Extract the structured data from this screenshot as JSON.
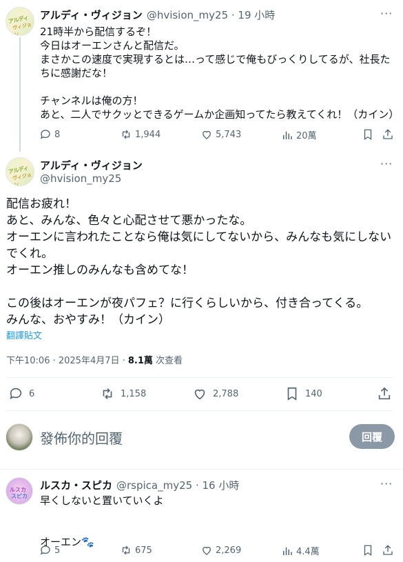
{
  "parent_tweet": {
    "avatar_text": [
      "アルディ",
      "ヴィジョン"
    ],
    "display_name": "アルディ・ヴィジョン",
    "handle_time": "@hvision_my25 · 19 小時",
    "more": "···",
    "text": "21時半から配信するぞ！\n今日はオーエンさんと配信だ。\nまさかこの速度で実現するとは…って感じで俺もびっくりしてるが、社長た\nちに感謝だな！\n\nチャンネルは俺の方！\nあと、二人でサクッとできるゲームか企画知ってたら教えてくれ！（カイン）",
    "replies": "8",
    "reposts": "1,944",
    "likes": "5,743",
    "views": "20萬"
  },
  "main_tweet": {
    "avatar_text": [
      "アルディ",
      "ヴィジョン"
    ],
    "display_name": "アルディ・ヴィジョン",
    "handle": "@hvision_my25",
    "more": "···",
    "text": "配信お疲れ！\nあと、みんな、色々と心配させて悪かったな。\nオーエンに言われたことなら俺は気にしてないから、みんなも気にしない\nでくれ。\nオーエン推しのみんなも含めてな！\n\nこの後はオーエンが夜パフェ？に行くらしいから、付き合ってくる。\nみんな、おやすみ！（カイン）",
    "translate": "翻譯貼文",
    "meta_time": "下午10:06 · 2025年4月7日 · ",
    "meta_views": "8.1萬",
    "meta_views_label": " 次查看",
    "replies": "6",
    "reposts": "1,158",
    "likes": "2,788",
    "bookmarks": "140"
  },
  "reply_composer": {
    "placeholder": "發佈你的回覆",
    "button": "回覆"
  },
  "reply_tweet": {
    "avatar_text": [
      "ルスカ",
      "スピカ"
    ],
    "display_name": "ルスカ・スピカ",
    "handle_time": "@rspica_my25 · 16 小時",
    "more": "···",
    "text_line1": "早くしないと置いていくよ",
    "text_line2": "オーエン",
    "emoji": "🐾",
    "replies": "5",
    "reposts": "675",
    "likes": "2,269",
    "views": "4.4萬"
  }
}
